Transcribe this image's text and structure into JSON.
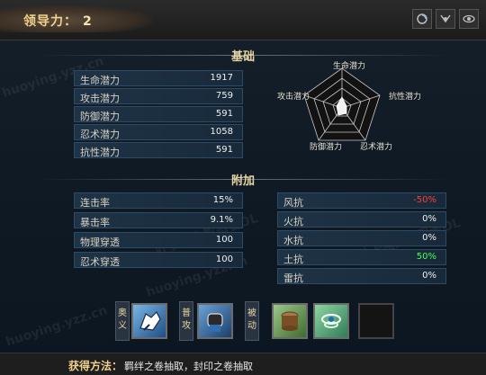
{
  "header": {
    "label": "领导力：",
    "value": "2"
  },
  "top_icons": [
    "swirl-icon",
    "mask-icon",
    "eye-icon"
  ],
  "sections": {
    "basic": "基础",
    "extra": "附加"
  },
  "basic_stats": [
    {
      "label": "生命潜力",
      "value": "1917"
    },
    {
      "label": "攻击潜力",
      "value": "759"
    },
    {
      "label": "防御潜力",
      "value": "591"
    },
    {
      "label": "忍术潜力",
      "value": "1058"
    },
    {
      "label": "抗性潜力",
      "value": "591"
    }
  ],
  "radar_labels": {
    "top": "生命潜力",
    "left": "攻击潜力",
    "right": "抗性潜力",
    "bottom_left": "防御潜力",
    "bottom_right": "忍术潜力"
  },
  "extra_left": [
    {
      "label": "连击率",
      "value": "15%"
    },
    {
      "label": "暴击率",
      "value": "9.1%"
    },
    {
      "label": "物理穿透",
      "value": "100"
    },
    {
      "label": "忍术穿透",
      "value": "100"
    }
  ],
  "extra_right": [
    {
      "label": "风抗",
      "value": "-50%",
      "color": "#ff3b3b"
    },
    {
      "label": "火抗",
      "value": "0%",
      "color": "#f0f0f0"
    },
    {
      "label": "水抗",
      "value": "0%",
      "color": "#f0f0f0"
    },
    {
      "label": "土抗",
      "value": "50%",
      "color": "#44ff5a"
    },
    {
      "label": "雷抗",
      "value": "0%",
      "color": "#f0f0f0"
    }
  ],
  "skill_tags": {
    "ougi": "奥义",
    "normal": "普攻",
    "passive": "被动"
  },
  "skills": [
    "ninja-hand-seal-icon",
    "fist-icon",
    "wood-stump-icon",
    "wind-spiral-icon",
    "empty-slot"
  ],
  "footer": {
    "label": "获得方法：",
    "text": "羁绊之卷抽取，封印之卷抽取"
  },
  "watermark": {
    "cn": "叶子猪火影忍者OL",
    "url": "huoying.yzz.cn"
  }
}
